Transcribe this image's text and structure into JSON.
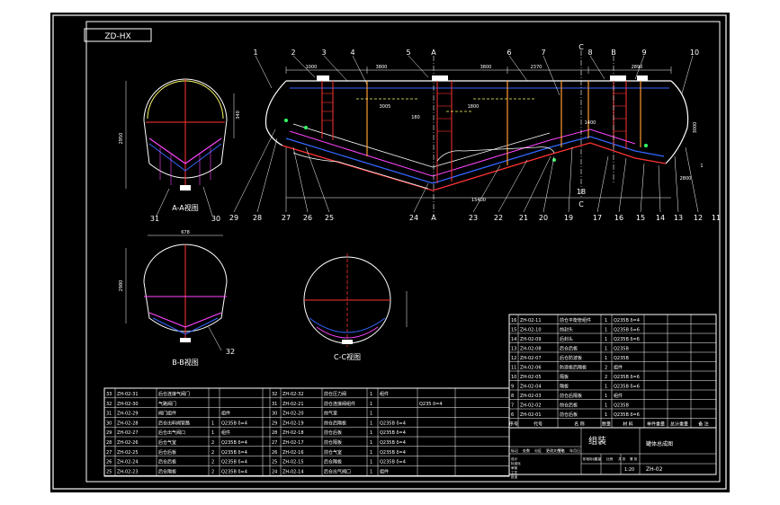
{
  "title_tag": "ZD-HX",
  "callouts_top": [
    "1",
    "2",
    "3",
    "4",
    "5",
    "A",
    "6",
    "7",
    "C",
    "8",
    "B",
    "9",
    "10"
  ],
  "callouts_bottom": [
    "29",
    "28",
    "27",
    "26",
    "25",
    "24",
    "A",
    "23",
    "22",
    "21",
    "20",
    "19",
    "18",
    "C",
    "17",
    "16",
    "15",
    "14",
    "13",
    "12",
    "11"
  ],
  "dims": [
    "1000",
    "3800",
    "3800",
    "2370",
    "2890",
    "3005",
    "180",
    "1800",
    "15400",
    "1400",
    "3000",
    "2800",
    "1"
  ],
  "views": {
    "aa": "A-A视图",
    "bb": "B-B视图",
    "cc": "C-C视图"
  },
  "view_callouts": {
    "aa_left": "31",
    "aa_right": "30",
    "bb_right": "32"
  },
  "view_dims": {
    "aa_h": "2950",
    "aa_w": "340",
    "bb_h": "2980",
    "bb_w": "678"
  },
  "left_table": [
    [
      "33",
      "ZH-02-31",
      "后仓连接气阀门",
      "",
      "",
      "",
      "32",
      "ZH-02-32",
      "前仓压力阀",
      "1",
      "组件",
      ""
    ],
    [
      "32",
      "ZH-02-30",
      "气路阀门",
      "",
      "",
      "",
      "31",
      "ZH-02-21",
      "前仓连接阀组件",
      "1",
      "",
      "Q235 δ=4"
    ],
    [
      "31",
      "ZH-02-29",
      "阀门组件",
      "",
      "组件",
      "",
      "30",
      "ZH-02-20",
      "前气室",
      "1",
      "",
      ""
    ],
    [
      "30",
      "ZH-02-28",
      "后仓出料阀管路",
      "1",
      "Q235B δ=4",
      "",
      "29",
      "ZH-02-19",
      "前仓后隔板",
      "1",
      "Q235B δ=4",
      ""
    ],
    [
      "29",
      "ZH-02-27",
      "后仓出气阀口",
      "1",
      "组件",
      "",
      "28",
      "ZH-02-18",
      "前仓后板",
      "1",
      "Q235B δ=4",
      ""
    ],
    [
      "28",
      "ZH-02-26",
      "后仓气室",
      "2",
      "Q235B δ=4",
      "",
      "27",
      "ZH-02-17",
      "前仓隔板",
      "1",
      "Q235B δ=4",
      ""
    ],
    [
      "27",
      "ZH-02-25",
      "后仓后板",
      "2",
      "Q235B δ=4",
      "",
      "26",
      "ZH-02-16",
      "前仓气室",
      "1",
      "Q235B δ=4",
      ""
    ],
    [
      "26",
      "ZH-02-24",
      "后仓后板",
      "2",
      "Q235B δ=4",
      "",
      "25",
      "ZH-02-15",
      "后仓隔板",
      "1",
      "Q235B δ=4",
      ""
    ],
    [
      "25",
      "ZH-02-23",
      "后仓隔板",
      "2",
      "Q235B δ=4",
      "",
      "24",
      "ZH-02-14",
      "后仓出气阀口",
      "1",
      "组件",
      ""
    ]
  ],
  "right_table": [
    [
      "16",
      "ZH-02-11",
      "前仓平衡管组件",
      "1",
      "Q235B δ=4"
    ],
    [
      "15",
      "ZH-02-10",
      "前封头",
      "1",
      "Q235B δ=6"
    ],
    [
      "14",
      "ZH-02-09",
      "后封头",
      "1",
      "Q235B δ=6"
    ],
    [
      "13",
      "ZH-02-08",
      "后仓后板",
      "1",
      "Q235B"
    ],
    [
      "12",
      "ZH-02-07",
      "后仓防波板",
      "1",
      "Q235B"
    ],
    [
      "11",
      "ZH-02-06",
      "防浪板后隔板",
      "2",
      "组件"
    ],
    [
      "10",
      "ZH-02-05",
      "隔板",
      "2",
      "Q235B δ=6"
    ],
    [
      "9",
      "ZH-02-04",
      "隔板",
      "1",
      "Q235B δ=6"
    ],
    [
      "8",
      "ZH-02-03",
      "前仓后隔板",
      "1",
      "组件"
    ],
    [
      "7",
      "ZH-02-02",
      "前仓后板",
      "1",
      "Q235B"
    ],
    [
      "6",
      "ZH-02-01",
      "前仓后板",
      "1",
      "Q235B δ=6"
    ]
  ],
  "right_table_header": [
    "序号",
    "代号",
    "名 称",
    "数量",
    "材 料",
    "单件重量",
    "总计重量",
    "备 注"
  ],
  "title_block": {
    "name": "组装",
    "drawing": "罐体总成图",
    "number": "ZH-02",
    "scale": "1:20",
    "labels": [
      "标记",
      "处数",
      "分区",
      "更改文件号",
      "签名",
      "年月日",
      "设计",
      "标准化",
      "审核",
      "工艺",
      "批准",
      "阶段标记",
      "重量",
      "比例",
      "共 张",
      "第 张"
    ]
  }
}
